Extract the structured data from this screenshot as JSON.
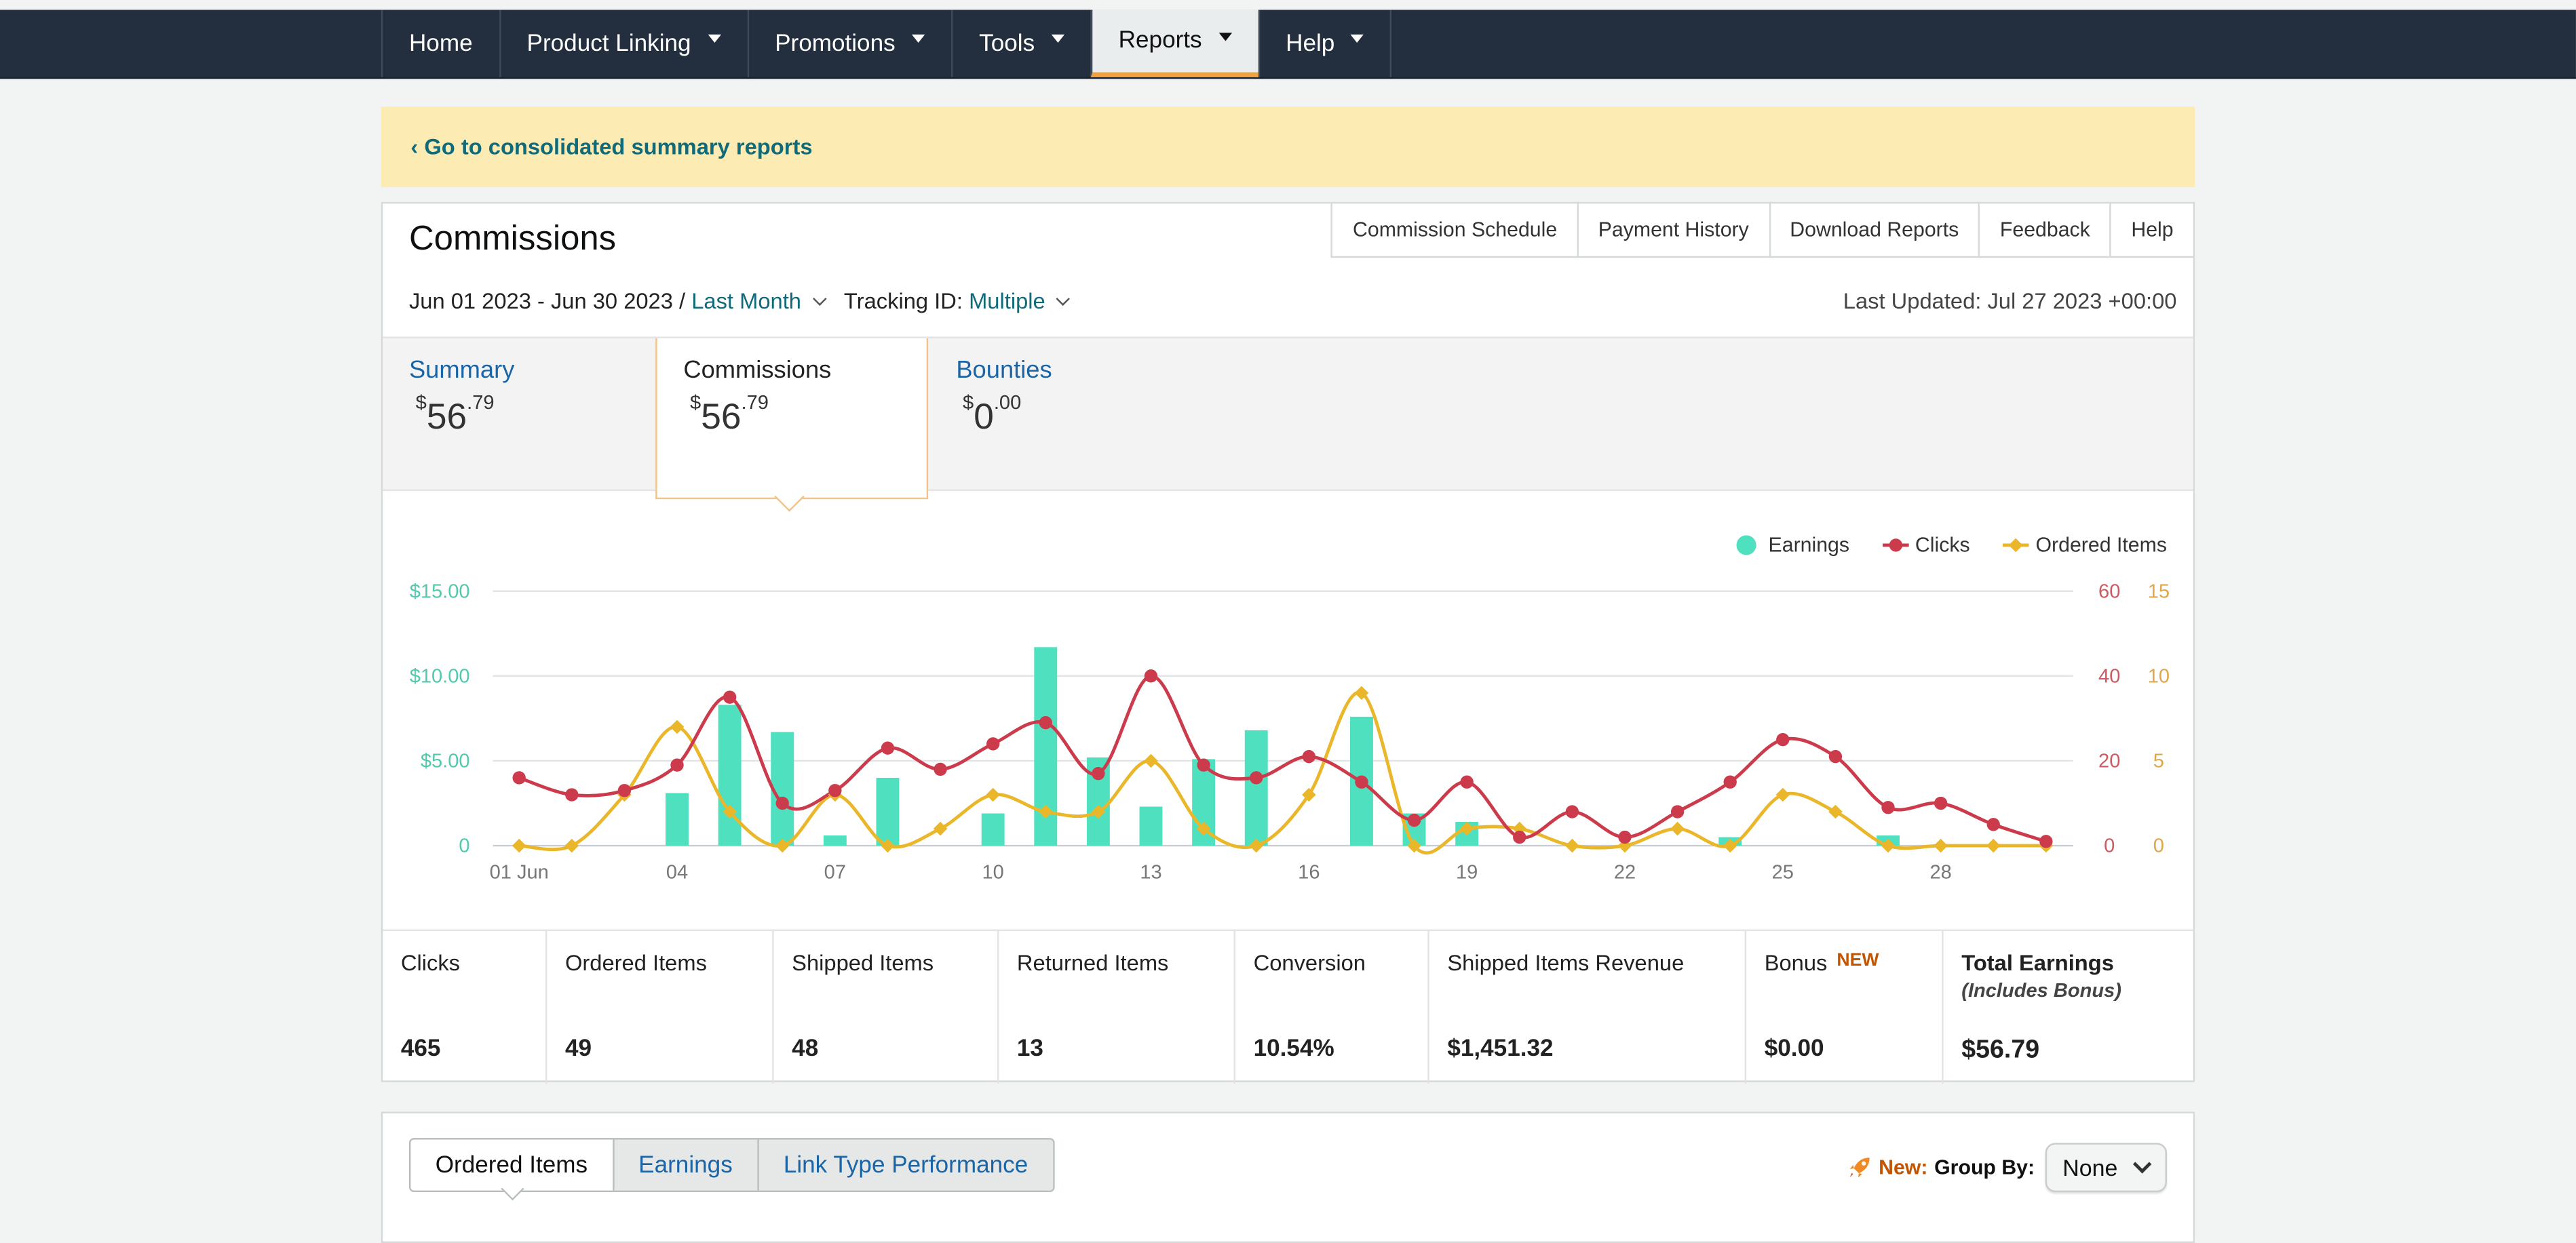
{
  "nav": {
    "items": [
      {
        "label": "Home",
        "caret": false
      },
      {
        "label": "Product Linking",
        "caret": true
      },
      {
        "label": "Promotions",
        "caret": true
      },
      {
        "label": "Tools",
        "caret": true
      },
      {
        "label": "Reports",
        "caret": true,
        "active": true
      },
      {
        "label": "Help",
        "caret": true
      }
    ]
  },
  "banner": {
    "link": "‹ Go to consolidated summary reports"
  },
  "report": {
    "title": "Commissions",
    "top_links": [
      "Commission Schedule",
      "Payment History",
      "Download Reports",
      "Feedback",
      "Help"
    ],
    "date_range": "Jun 01 2023 - Jun 30 2023 /",
    "period": "Last Month",
    "tracking_label": "Tracking ID:",
    "tracking_value": "Multiple",
    "last_updated": "Last Updated: Jul 27 2023 +00:00"
  },
  "summary_tabs": [
    {
      "label": "Summary",
      "currency": "$",
      "whole": "56",
      "cents": ".79"
    },
    {
      "label": "Commissions",
      "currency": "$",
      "whole": "56",
      "cents": ".79",
      "selected": true
    },
    {
      "label": "Bounties",
      "currency": "$",
      "whole": "0",
      "cents": ".00"
    }
  ],
  "chart_data": {
    "type": "bar",
    "x_tick_labels": [
      "01 Jun",
      "04",
      "07",
      "10",
      "13",
      "16",
      "19",
      "22",
      "25",
      "28"
    ],
    "x_tick_days": [
      1,
      4,
      7,
      10,
      13,
      16,
      19,
      22,
      25,
      28
    ],
    "days": [
      1,
      2,
      3,
      4,
      5,
      6,
      7,
      8,
      9,
      10,
      11,
      12,
      13,
      14,
      15,
      16,
      17,
      18,
      19,
      20,
      21,
      22,
      23,
      24,
      25,
      26,
      27,
      28,
      29,
      30
    ],
    "legend": [
      "Earnings",
      "Clicks",
      "Ordered Items"
    ],
    "colors": {
      "earnings": "#4fe0c0",
      "clicks": "#cc3b4c",
      "ordered": "#eab72b"
    },
    "axes": {
      "left": {
        "ticks": [
          "0",
          "$5.00",
          "$10.00",
          "$15.00"
        ],
        "range": [
          0,
          15
        ]
      },
      "right_clicks": {
        "ticks": [
          "0",
          "20",
          "40",
          "60"
        ],
        "range": [
          0,
          60
        ]
      },
      "right_ordered": {
        "ticks": [
          "0",
          "5",
          "10",
          "15"
        ],
        "range": [
          0,
          15
        ]
      }
    },
    "series": [
      {
        "name": "Earnings",
        "kind": "bar",
        "values": [
          0,
          0,
          0,
          3.1,
          8.3,
          6.7,
          0.6,
          4.0,
          0,
          1.9,
          11.7,
          5.2,
          2.3,
          5.1,
          6.8,
          0,
          7.6,
          1.9,
          1.4,
          0,
          0,
          0,
          0,
          0.5,
          0,
          0,
          0.6,
          0,
          0,
          0
        ]
      },
      {
        "name": "Clicks",
        "kind": "line",
        "values": [
          16,
          12,
          13,
          19,
          35,
          10,
          13,
          23,
          18,
          24,
          29,
          17,
          40,
          19,
          16,
          21,
          15,
          6,
          15,
          2,
          8,
          2,
          8,
          15,
          25,
          21,
          9,
          10,
          5,
          1
        ]
      },
      {
        "name": "Ordered Items",
        "kind": "line",
        "values": [
          0,
          0,
          3,
          7,
          2,
          0,
          3,
          0,
          1,
          3,
          2,
          2,
          5,
          1,
          0,
          3,
          9,
          0,
          1,
          1,
          0,
          0,
          1,
          0,
          3,
          2,
          0,
          0,
          0,
          0
        ]
      }
    ],
    "grid": true
  },
  "metrics": [
    {
      "label": "Clicks",
      "value": "465"
    },
    {
      "label": "Ordered Items",
      "value": "49"
    },
    {
      "label": "Shipped Items",
      "value": "48"
    },
    {
      "label": "Returned Items",
      "value": "13"
    },
    {
      "label": "Conversion",
      "value": "10.54%"
    },
    {
      "label": "Shipped Items Revenue",
      "value": "$1,451.32"
    },
    {
      "label": "Bonus",
      "badge": "NEW",
      "value": "$0.00"
    },
    {
      "label": "Total Earnings",
      "sub": "(Includes Bonus)",
      "value": "$56.79"
    }
  ],
  "bottom": {
    "tabs": [
      "Ordered Items",
      "Earnings",
      "Link Type Performance"
    ],
    "new_label": "New:",
    "group_by_label": "Group By:",
    "group_by_value": "None",
    "icon": "rocket-icon"
  }
}
